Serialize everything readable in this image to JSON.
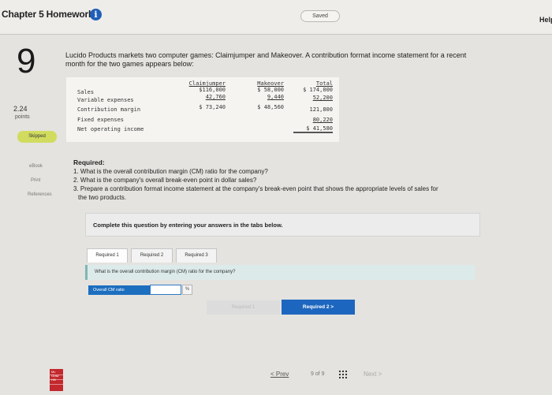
{
  "header": {
    "title": "Chapter 5 Homework",
    "info_icon": "i",
    "saved": "Saved",
    "help": "Help"
  },
  "left_rail": {
    "question_number": "9",
    "points_value": "2.24",
    "points_label": "points",
    "status": "Skipped",
    "ebook": "eBook",
    "print": "Print",
    "references": "References"
  },
  "question": {
    "line1": "Lucido Products markets two computer games: Claimjumper and Makeover. A contribution format income statement for a recent",
    "line2": "month for the two games appears below:"
  },
  "statement": {
    "headers": [
      "Claimjumper",
      "Makeover",
      "Total"
    ],
    "rows": [
      {
        "label": "Sales",
        "c1": "$116,000",
        "c2": "$ 58,000",
        "c3": "$ 174,000"
      },
      {
        "label": "Variable expenses",
        "c1": "42,760",
        "c2": "9,440",
        "c3": "52,200"
      },
      {
        "label": "Contribution margin",
        "c1": "$ 73,240",
        "c2": "$ 48,560",
        "c3": "121,800"
      },
      {
        "label": "Fixed expenses",
        "c1": "",
        "c2": "",
        "c3": "80,220"
      },
      {
        "label": "Net operating income",
        "c1": "",
        "c2": "",
        "c3": "$  41,580"
      }
    ]
  },
  "required": {
    "heading": "Required:",
    "item1": "1. What is the overall contribution margin (CM) ratio for the company?",
    "item2": "2. What is the company's overall break-even point in dollar sales?",
    "item3a": "3. Prepare a contribution format income statement at the company's break-even point that shows the appropriate levels of sales for",
    "item3b": "the two products."
  },
  "panel": {
    "instruction": "Complete this question by entering your answers in the tabs below.",
    "tabs": [
      "Required 1",
      "Required 2",
      "Required 3"
    ],
    "question": "What is the overall contribution margin (CM) ratio for the company?",
    "answer_label": "Overall CM ratio",
    "answer_value": "",
    "unit": "%",
    "prev_button": "Required 1",
    "next_button": "Required 2  >"
  },
  "nav": {
    "logo_text": "Mc Graw Hill",
    "prev": "< Prev",
    "page": "9  of  9",
    "next": "Next >"
  }
}
